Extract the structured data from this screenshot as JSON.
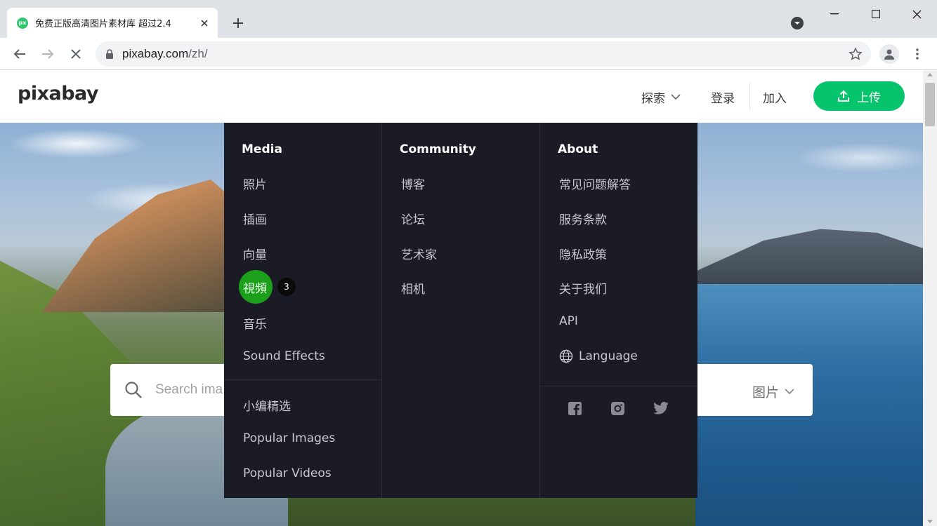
{
  "browser": {
    "tab_title": "免费正版高清图片素材库 超过2.4",
    "favicon_text": "px",
    "url_host": "pixabay.com",
    "url_path": "/zh/"
  },
  "header": {
    "logo": "pixabay",
    "explore": "探索",
    "login": "登录",
    "join": "加入",
    "upload": "上传"
  },
  "search": {
    "placeholder": "Search ima",
    "type": "图片"
  },
  "menu": {
    "media": {
      "heading": "Media",
      "items": [
        "照片",
        "插画",
        "向量",
        "視頻",
        "音乐",
        "Sound Effects"
      ],
      "extra": [
        "小编精选",
        "Popular Images",
        "Popular Videos"
      ],
      "badge": "3"
    },
    "community": {
      "heading": "Community",
      "items": [
        "博客",
        "论坛",
        "艺术家",
        "相机"
      ]
    },
    "about": {
      "heading": "About",
      "items": [
        "常见问题解答",
        "服务条款",
        "隐私政策",
        "关于我们",
        "API",
        "Language"
      ]
    }
  },
  "colors": {
    "brand_green": "#05c46b",
    "menu_bg": "#1a1b24",
    "highlight_green": "#1ca01c"
  }
}
